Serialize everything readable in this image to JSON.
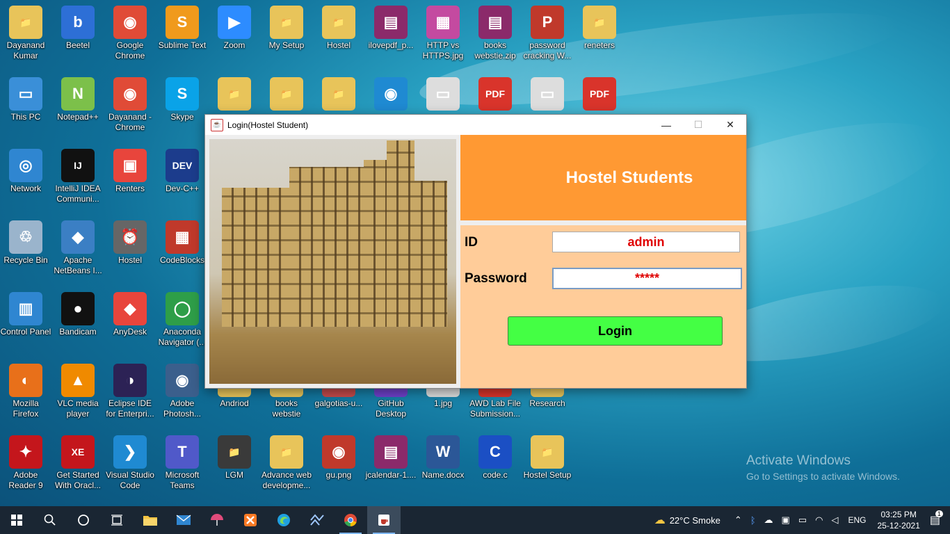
{
  "desktop": {
    "icons": [
      {
        "label": "Dayanand Kumar",
        "glyph": "📁",
        "color": "#e8c45a"
      },
      {
        "label": "Beetel",
        "glyph": "b",
        "color": "#2d6fd6"
      },
      {
        "label": "Google Chrome",
        "glyph": "◉",
        "color": "#e04b37"
      },
      {
        "label": "Sublime Text",
        "glyph": "S",
        "color": "#f09a1c"
      },
      {
        "label": "Zoom",
        "glyph": "▶",
        "color": "#2d8cff"
      },
      {
        "label": "My Setup",
        "glyph": "📁",
        "color": "#e8c45a"
      },
      {
        "label": "Hostel",
        "glyph": "📁",
        "color": "#e8c45a"
      },
      {
        "label": "ilovepdf_p...",
        "glyph": "▤",
        "color": "#8b2a6a"
      },
      {
        "label": "HTTP vs HTTPS.jpg",
        "glyph": "▦",
        "color": "#c44aa0"
      },
      {
        "label": "books webstie.zip",
        "glyph": "▤",
        "color": "#8b2a6a"
      },
      {
        "label": "password cracking W...",
        "glyph": "P",
        "color": "#c0392b"
      },
      {
        "label": "reneters",
        "glyph": "📁",
        "color": "#e8c45a"
      },
      {
        "label": "This PC",
        "glyph": "▭",
        "color": "#3a8fd8"
      },
      {
        "label": "Notepad++",
        "glyph": "N",
        "color": "#7cc04a"
      },
      {
        "label": "Dayanand - Chrome",
        "glyph": "◉",
        "color": "#e04b37"
      },
      {
        "label": "Skype",
        "glyph": "S",
        "color": "#0aa3e8"
      },
      {
        "label": "IntelliJ IDEA Communi...",
        "glyph": "IJ",
        "color": "#111111"
      },
      {
        "label": "Renters",
        "glyph": "▣",
        "color": "#e8453c"
      },
      {
        "label": "Dev-C++",
        "glyph": "DEV",
        "color": "#1c3c8c"
      },
      {
        "label": "Network",
        "glyph": "◎",
        "color": "#2f86d1"
      },
      {
        "label": "Recycle Bin",
        "glyph": "♲",
        "color": "#9ab4cc"
      },
      {
        "label": "Apache NetBeans I...",
        "glyph": "◆",
        "color": "#3b7fc4"
      },
      {
        "label": "Hostel",
        "glyph": "⏰",
        "color": "#666666"
      },
      {
        "label": "CodeBlocks",
        "glyph": "▦",
        "color": "#c0392b"
      },
      {
        "label": "Control Panel",
        "glyph": "▥",
        "color": "#2f86d1"
      },
      {
        "label": "Bandicam",
        "glyph": "●",
        "color": "#111111"
      },
      {
        "label": "AnyDesk",
        "glyph": "◆",
        "color": "#e8453c"
      },
      {
        "label": "Anaconda Navigator (...",
        "glyph": "◯",
        "color": "#2e9e48"
      },
      {
        "label": "Mozilla Firefox",
        "glyph": "◐",
        "color": "#e8701a"
      },
      {
        "label": "VLC media player",
        "glyph": "▲",
        "color": "#f08a00"
      },
      {
        "label": "Eclipse IDE for Enterpri...",
        "glyph": "◑",
        "color": "#2c2255"
      },
      {
        "label": "Adobe Photosh...",
        "glyph": "◉",
        "color": "#3b5f8c"
      },
      {
        "label": "Andriod",
        "glyph": "📁",
        "color": "#e8c45a"
      },
      {
        "label": "books webstie",
        "glyph": "📁",
        "color": "#e8c45a"
      },
      {
        "label": "galgotias-u...",
        "glyph": "▦",
        "color": "#c44a4a"
      },
      {
        "label": "GitHub Desktop",
        "glyph": "◉",
        "color": "#6e40c9"
      },
      {
        "label": "1.jpg",
        "glyph": "▭",
        "color": "#dddddd"
      },
      {
        "label": "AWD Lab File Submission...",
        "glyph": "PDF",
        "color": "#d9342b"
      },
      {
        "label": "Research",
        "glyph": "📁",
        "color": "#e8c45a"
      },
      {
        "label": "Adobe Reader 9",
        "glyph": "✦",
        "color": "#c4161c"
      },
      {
        "label": "Get Started With Oracl...",
        "glyph": "XE",
        "color": "#c4161c"
      },
      {
        "label": "Visual Studio Code",
        "glyph": "❯",
        "color": "#1f8ad2"
      },
      {
        "label": "Microsoft Teams",
        "glyph": "T",
        "color": "#5059c9"
      },
      {
        "label": "LGM",
        "glyph": "📁",
        "color": "#3a3a3a"
      },
      {
        "label": "Advance web developme...",
        "glyph": "📁",
        "color": "#e8c45a"
      },
      {
        "label": "gu.png",
        "glyph": "◉",
        "color": "#c0392b"
      },
      {
        "label": "jcalendar-1....",
        "glyph": "▤",
        "color": "#8b2a6a"
      },
      {
        "label": "Name.docx",
        "glyph": "W",
        "color": "#2b5797"
      },
      {
        "label": "code.c",
        "glyph": "C",
        "color": "#1b4fc4"
      },
      {
        "label": "Hostel Setup",
        "glyph": "📁",
        "color": "#e8c45a"
      },
      {
        "label": "",
        "glyph": "📁",
        "color": "#e8c45a"
      },
      {
        "label": "",
        "glyph": "📁",
        "color": "#e8c45a"
      },
      {
        "label": "",
        "glyph": "📁",
        "color": "#e8c45a"
      },
      {
        "label": "",
        "glyph": "◉",
        "color": "#1f8ad2"
      },
      {
        "label": "",
        "glyph": "▭",
        "color": "#dddddd"
      },
      {
        "label": "",
        "glyph": "PDF",
        "color": "#d9342b"
      },
      {
        "label": "",
        "glyph": "▭",
        "color": "#dddddd"
      },
      {
        "label": "",
        "glyph": "PDF",
        "color": "#d9342b"
      }
    ]
  },
  "window": {
    "title": "Login(Hostel Student)",
    "java_icon": "☕",
    "minimize": "—",
    "maximize": "☐",
    "close": "✕"
  },
  "form": {
    "heading": "Hostel Students",
    "id_label": "ID",
    "id_value": "admin",
    "password_label": "Password",
    "password_value": "*****",
    "login_label": "Login"
  },
  "watermark": {
    "title": "Activate Windows",
    "subtitle": "Go to Settings to activate Windows."
  },
  "taskbar": {
    "weather": "22°C  Smoke",
    "language": "ENG",
    "time": "03:25 PM",
    "date": "25-12-2021",
    "notification_count": "1"
  }
}
